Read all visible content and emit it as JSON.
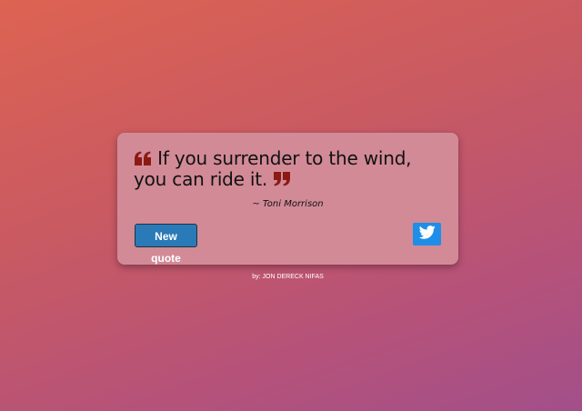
{
  "quote": {
    "text": "If you surrender to the wind, you can ride it.",
    "author": "~ Toni Morrison",
    "open_mark_icon": "quote-left-icon",
    "close_mark_icon": "quote-right-icon",
    "mark_color": "#8b1a12"
  },
  "actions": {
    "new_quote_label": "New quote",
    "tweet_icon": "twitter-icon",
    "tweet_color": "#1e8ee8"
  },
  "footer": {
    "prefix": "by:",
    "name": "JON DERECK NIFAS"
  }
}
